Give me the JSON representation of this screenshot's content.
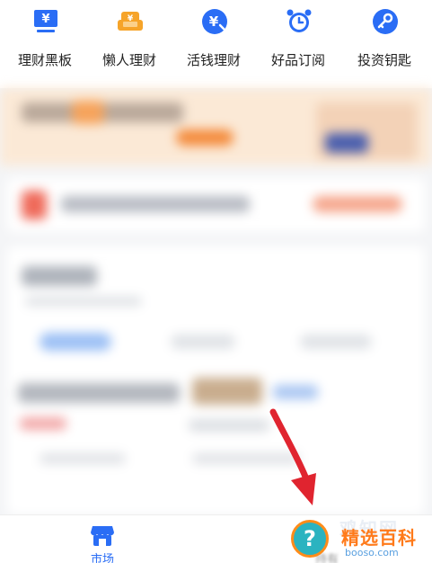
{
  "top_nav": {
    "items": [
      {
        "label": "理财黑板",
        "icon": "blackboard-yen-icon"
      },
      {
        "label": "懒人理财",
        "icon": "sofa-icon"
      },
      {
        "label": "活钱理财",
        "icon": "yen-coin-icon"
      },
      {
        "label": "好品订阅",
        "icon": "alarm-clock-icon"
      },
      {
        "label": "投资钥匙",
        "icon": "key-icon"
      }
    ]
  },
  "tab_bar": {
    "market_label": "市场",
    "hold_label": "持有"
  },
  "watermark": {
    "top": "鸡知网",
    "main": "精选百科",
    "sub": "booso.com",
    "mark": "?"
  },
  "colors": {
    "accent_blue": "#2a6df5",
    "accent_orange": "#f6a429",
    "arrow_red": "#e0242f"
  }
}
